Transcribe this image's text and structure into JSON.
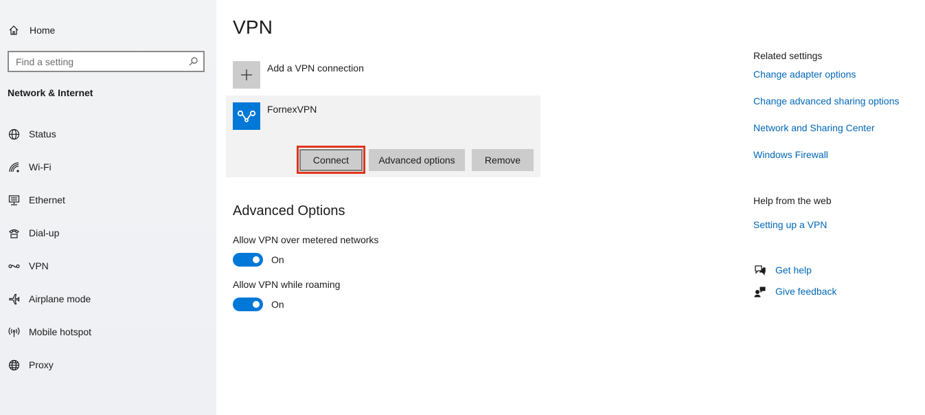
{
  "sidebar": {
    "home_label": "Home",
    "search_placeholder": "Find a setting",
    "section_title": "Network & Internet",
    "items": [
      {
        "label": "Status",
        "icon": "globe-status-icon"
      },
      {
        "label": "Wi-Fi",
        "icon": "wifi-icon"
      },
      {
        "label": "Ethernet",
        "icon": "ethernet-icon"
      },
      {
        "label": "Dial-up",
        "icon": "dialup-icon"
      },
      {
        "label": "VPN",
        "icon": "vpn-icon"
      },
      {
        "label": "Airplane mode",
        "icon": "airplane-icon"
      },
      {
        "label": "Mobile hotspot",
        "icon": "hotspot-icon"
      },
      {
        "label": "Proxy",
        "icon": "globe-icon"
      }
    ]
  },
  "main": {
    "title": "VPN",
    "add_vpn_label": "Add a VPN connection",
    "connection": {
      "name": "FornexVPN",
      "connect_label": "Connect",
      "advanced_label": "Advanced options",
      "remove_label": "Remove"
    },
    "advanced": {
      "title": "Advanced Options",
      "options": [
        {
          "label": "Allow VPN over metered networks",
          "state": "On",
          "enabled": true
        },
        {
          "label": "Allow VPN while roaming",
          "state": "On",
          "enabled": true
        }
      ]
    }
  },
  "right": {
    "related_title": "Related settings",
    "related_links": [
      "Change adapter options",
      "Change advanced sharing options",
      "Network and Sharing Center",
      "Windows Firewall"
    ],
    "web_title": "Help from the web",
    "web_links": [
      "Setting up a VPN"
    ],
    "get_help": "Get help",
    "give_feedback": "Give feedback"
  },
  "colors": {
    "accent": "#0078d7",
    "link": "#0067b8",
    "highlight": "#e2331c"
  }
}
